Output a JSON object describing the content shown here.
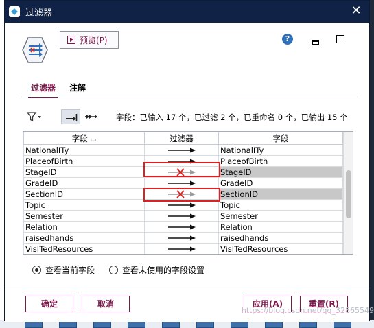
{
  "window": {
    "title": "过滤器",
    "close_glyph": "✕"
  },
  "toolbar_top": {
    "preview_label": "预览(P)",
    "help_glyph": "?"
  },
  "tabs": [
    {
      "label": "过滤器",
      "active": true
    },
    {
      "label": "注解",
      "active": false
    }
  ],
  "field_toolbar": {
    "funnel_icon": "filter-funnel-icon",
    "summary": "字段：已输入 17 个，已过滤 2 个，已重命名 0 个，已输出 15 个"
  },
  "grid": {
    "columns": [
      "字段",
      "过滤器",
      "字段"
    ],
    "rows": [
      {
        "in": "NationalITy",
        "filtered": false,
        "out": "NationalITy"
      },
      {
        "in": "PlaceofBirth",
        "filtered": false,
        "out": "PlaceofBirth"
      },
      {
        "in": "StageID",
        "filtered": true,
        "out": "StageID"
      },
      {
        "in": "GradeID",
        "filtered": false,
        "out": "GradeID"
      },
      {
        "in": "SectionID",
        "filtered": true,
        "out": "SectionID"
      },
      {
        "in": "Topic",
        "filtered": false,
        "out": "Topic"
      },
      {
        "in": "Semester",
        "filtered": false,
        "out": "Semester"
      },
      {
        "in": "Relation",
        "filtered": false,
        "out": "Relation"
      },
      {
        "in": "raisedhands",
        "filtered": false,
        "out": "raisedhands"
      },
      {
        "in": "VisITedResources",
        "filtered": false,
        "out": "VisITedResources"
      }
    ]
  },
  "view_options": {
    "current_fields": "查看当前字段",
    "unused_settings": "查看未使用的字段设置",
    "selected": "current_fields"
  },
  "buttons": {
    "ok": "确定",
    "cancel": "取消",
    "apply": "应用(A)",
    "reset": "重置(R)"
  },
  "watermark": "https://blog.csdn.net/qq_32865549",
  "colors": {
    "titlebar": "#102347",
    "accent": "#7a1a4a",
    "highlight": "#e02020",
    "filtered_out_bg": "#c8c8c8"
  }
}
